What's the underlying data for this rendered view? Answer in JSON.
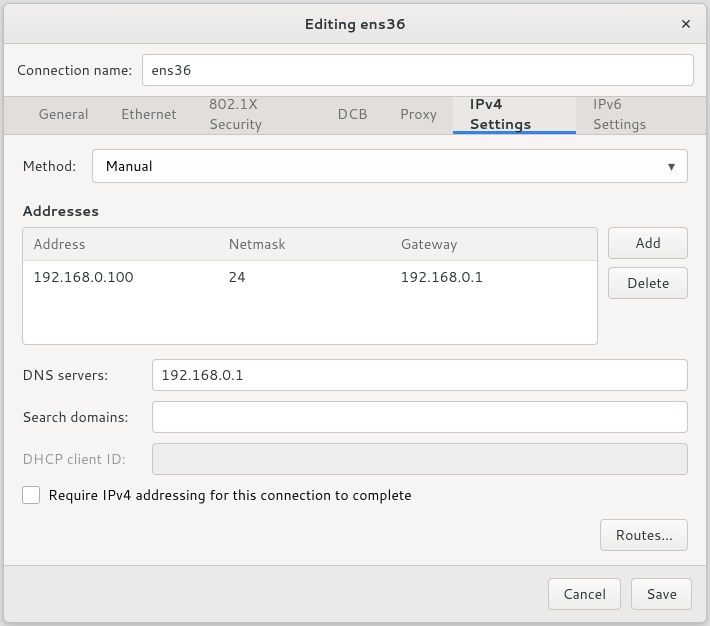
{
  "window": {
    "title": "Editing ens36"
  },
  "connection": {
    "label": "Connection name:",
    "value": "ens36"
  },
  "tabs": {
    "general": "General",
    "ethernet": "Ethernet",
    "x8021": "802.1X Security",
    "dcb": "DCB",
    "proxy": "Proxy",
    "ipv4": "IPv4 Settings",
    "ipv6": "IPv6 Settings"
  },
  "method": {
    "label": "Method:",
    "value": "Manual"
  },
  "addresses": {
    "title": "Addresses",
    "headers": {
      "address": "Address",
      "netmask": "Netmask",
      "gateway": "Gateway"
    },
    "rows": [
      {
        "address": "192.168.0.100",
        "netmask": "24",
        "gateway": "192.168.0.1"
      }
    ],
    "add": "Add",
    "delete": "Delete"
  },
  "dns": {
    "label": "DNS servers:",
    "value": "192.168.0.1"
  },
  "search": {
    "label": "Search domains:",
    "value": ""
  },
  "dhcp": {
    "label": "DHCP client ID:",
    "value": ""
  },
  "require": {
    "label": "Require IPv4 addressing for this connection to complete"
  },
  "routes": {
    "label": "Routes…"
  },
  "footer": {
    "cancel": "Cancel",
    "save": "Save"
  }
}
